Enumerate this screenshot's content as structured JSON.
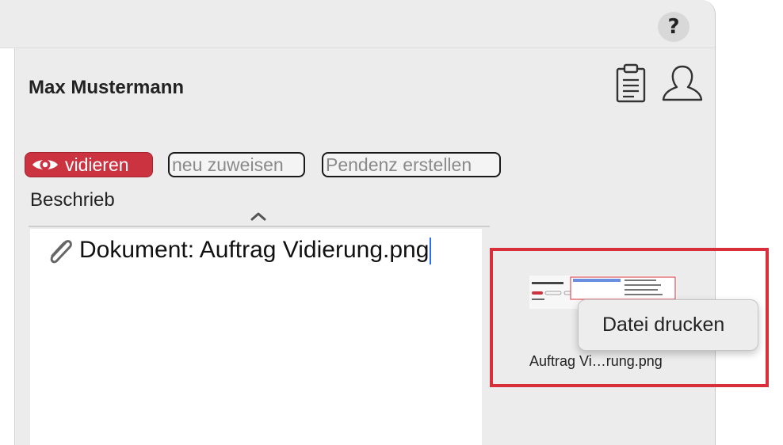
{
  "help": {
    "label": "?"
  },
  "header": {
    "name": "Max Mustermann",
    "icons": [
      "clipboard-icon",
      "user-icon"
    ]
  },
  "actions": {
    "vidieren": "vidieren",
    "neu_zuweisen": "neu zuweisen",
    "pendenz_erstellen": "Pendenz erstellen"
  },
  "beschrieb": {
    "label": "Beschrieb",
    "content": "Dokument: Auftrag Vidierung.png"
  },
  "attachment": {
    "caption": "Auftrag Vi…rung.png"
  },
  "context_menu": {
    "items": [
      "Datei drucken"
    ]
  },
  "colors": {
    "accent_red": "#cc3340",
    "highlight_border": "#d92f3a",
    "caret": "#2a6ff0"
  }
}
